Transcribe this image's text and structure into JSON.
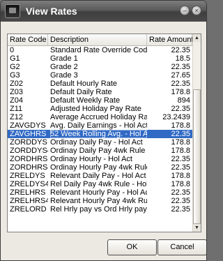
{
  "window": {
    "title": "View Rates"
  },
  "columns": {
    "code": "Rate Code",
    "description": "Description",
    "amount": "Rate Amount"
  },
  "rows": [
    {
      "code": "0",
      "description": "Standard Rate Override Code",
      "amount": "22.35"
    },
    {
      "code": "G1",
      "description": "Grade 1",
      "amount": "18.5"
    },
    {
      "code": "G2",
      "description": "Grade 2",
      "amount": "22.35"
    },
    {
      "code": "G3",
      "description": "Grade 3",
      "amount": "27.65"
    },
    {
      "code": "Z02",
      "description": "Default Hourly Rate",
      "amount": "22.35"
    },
    {
      "code": "Z03",
      "description": "Default Daily Rate",
      "amount": "178.8"
    },
    {
      "code": "Z04",
      "description": "Default Weekly Rate",
      "amount": "894"
    },
    {
      "code": "Z11",
      "description": "Adjusted Holiday Pay Rate",
      "amount": "22.35"
    },
    {
      "code": "Z12",
      "description": "Average Accrued Holiday Rate",
      "amount": "23.2439"
    },
    {
      "code": "ZAVGDYS",
      "description": "Avg. Daily Earnings - Hol Act",
      "amount": "178.8"
    },
    {
      "code": "ZAVGHRS",
      "description": "52 Week Rolling Avg. - Hol Act",
      "amount": "22.35",
      "selected": true
    },
    {
      "code": "ZORDDYS",
      "description": "Ordinay Daily Pay - Hol Act",
      "amount": "178.8"
    },
    {
      "code": "ZORDDYS4",
      "description": "Ordinay Daily Pay 4wk Rule",
      "amount": "178.8"
    },
    {
      "code": "ZORDHRS",
      "description": "Ordinay Hourly - Hol Act",
      "amount": "22.35"
    },
    {
      "code": "ZORDHRS4",
      "description": "Ordinay Hourly Pay 4wk Rule",
      "amount": "22.35"
    },
    {
      "code": "ZRELDYS",
      "description": "Relevant Daily Pay - Hol Act",
      "amount": "178.8"
    },
    {
      "code": "ZRELDYS4",
      "description": "Rel Daily Pay 4wk Rule - Hol A",
      "amount": "178.8"
    },
    {
      "code": "ZRELHRS",
      "description": "Relevant Hourly Pay - Hol Act",
      "amount": "22.35"
    },
    {
      "code": "ZRELHRS4",
      "description": "Relevant Hourly Pay 4wk Rule",
      "amount": "22.35"
    },
    {
      "code": "ZRELORD",
      "description": "Rel Hrly pay vs Ord Hrly pay",
      "amount": "22.35"
    },
    {
      "code": "",
      "description": "",
      "amount": ""
    }
  ],
  "buttons": {
    "ok": "OK",
    "cancel": "Cancel"
  },
  "icons": {
    "app": "app-icon",
    "minimize": "minimize-icon",
    "close": "close-icon",
    "scroll_up": "scroll-up-arrow-icon",
    "scroll_down": "scroll-down-arrow-icon"
  },
  "colors": {
    "selection": "#316ac5",
    "titlebar": "#4a4a4a",
    "dialog_bg": "#ece9e2"
  }
}
